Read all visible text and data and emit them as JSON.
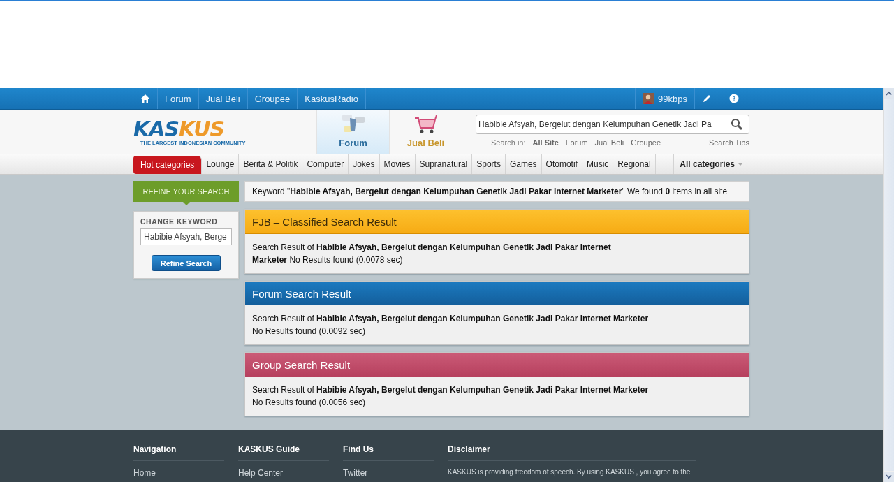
{
  "topbar": {
    "nav": [
      {
        "label": "Forum"
      },
      {
        "label": "Jual Beli"
      },
      {
        "label": "Groupee"
      },
      {
        "label": "KaskusRadio"
      }
    ],
    "user": "99kbps"
  },
  "header": {
    "logo_parts": [
      "KAS",
      "KUS"
    ],
    "tagline": "THE LARGEST INDONESIAN COMMUNITY",
    "sections": [
      {
        "label": "Forum",
        "kind": "forum",
        "selected": true
      },
      {
        "label": "Jual Beli",
        "kind": "shop",
        "selected": false
      }
    ],
    "search": {
      "value": "Habibie Afsyah, Bergelut dengan Kelumpuhan Genetik Jadi Pa",
      "scope_label": "Search in:",
      "scopes": [
        {
          "label": "All Site",
          "selected": true
        },
        {
          "label": "Forum",
          "selected": false
        },
        {
          "label": "Jual Beli",
          "selected": false
        },
        {
          "label": "Groupee",
          "selected": false
        }
      ],
      "tips": "Search Tips"
    }
  },
  "categories": {
    "hot": "Hot categories",
    "items": [
      "Lounge",
      "Berita & Politik",
      "Computer",
      "Jokes",
      "Movies",
      "Supranatural",
      "Sports",
      "Games",
      "Otomotif",
      "Music",
      "Regional"
    ],
    "all": "All categories"
  },
  "sidebar": {
    "title": "REFINE YOUR SEARCH",
    "label": "CHANGE KEYWORD",
    "keyword": "Habibie Afsyah, Berge",
    "button": "Refine Search"
  },
  "summary": "Keyword \"**Habibie Afsyah, Bergelut dengan Kelumpuhan Genetik Jadi Pakar Internet Marketer**\" We found **0** items in all site",
  "panels": [
    {
      "kind": "fjb",
      "title": "FJB – Classified Search Result",
      "query": "Search Result of **Habibie Afsyah, Bergelut dengan Kelumpuhan Genetik Jadi Pakar Internet Marketer**",
      "result": "No Results found (0.0078 sec)"
    },
    {
      "kind": "forum",
      "title": "Forum Search Result",
      "query": "Search Result of **Habibie Afsyah, Bergelut dengan Kelumpuhan Genetik Jadi Pakar Internet Marketer**",
      "result": "No Results found (0.0092 sec)"
    },
    {
      "kind": "group",
      "title": "Group Search Result",
      "query": "Search Result of **Habibie Afsyah, Bergelut dengan Kelumpuhan Genetik Jadi Pakar Internet Marketer**",
      "result": "No Results found (0.0056 sec)"
    }
  ],
  "footer": [
    {
      "title": "Navigation",
      "links": [
        "Home"
      ]
    },
    {
      "title": "KASKUS Guide",
      "links": [
        "Help Center"
      ]
    },
    {
      "title": "Find Us",
      "links": [
        "Twitter"
      ]
    },
    {
      "title": "Disclaimer",
      "text": "KASKUS is providing freedom of speech. By using KASKUS , you agree to the"
    }
  ]
}
